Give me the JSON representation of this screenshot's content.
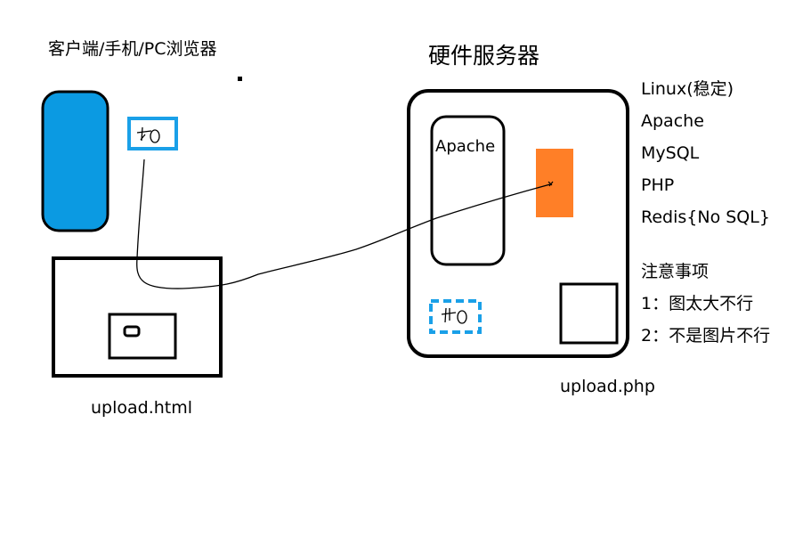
{
  "client": {
    "title": "客户端/手机/PC浏览器",
    "page_label": "upload.html"
  },
  "server": {
    "title": "硬件服务器",
    "apache_label": "Apache",
    "page_label": "upload.php"
  },
  "stack": [
    "Linux(稳定)",
    "Apache",
    "MySQL",
    "PHP",
    "Redis{No SQL}"
  ],
  "notes": {
    "title": "注意事项",
    "items": [
      "1：图太大不行",
      "2：不是图片不行"
    ]
  },
  "colors": {
    "phone": "#0b9ae2",
    "file_box": "#1aa0e8",
    "php_block": "#ff7f27",
    "stroke": "#000000"
  }
}
